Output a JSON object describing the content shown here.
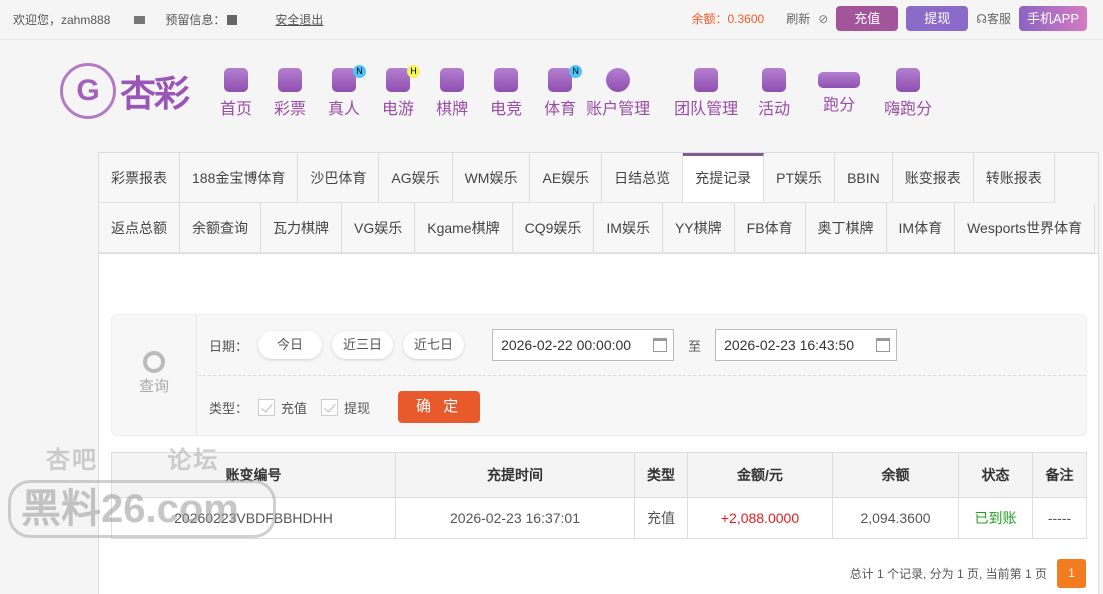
{
  "topbar": {
    "welcome": "欢迎您，zahm888",
    "reserve_info": "预留信息：",
    "logout": "安全退出",
    "balance_label": "余额：",
    "balance": "0.3600",
    "refresh": "刷新",
    "deposit": "充值",
    "withdraw": "提现",
    "service": "客服",
    "app": "手机APP"
  },
  "logo": {
    "text": "杏彩"
  },
  "nav": [
    {
      "label": "首页"
    },
    {
      "label": "彩票"
    },
    {
      "label": "真人",
      "badge": "N"
    },
    {
      "label": "电游",
      "badge": "H"
    },
    {
      "label": "棋牌"
    },
    {
      "label": "电竞"
    },
    {
      "label": "体育",
      "badge": "N"
    },
    {
      "label": "账户管理"
    },
    {
      "label": "团队管理"
    },
    {
      "label": "活动"
    },
    {
      "label": "跑分"
    },
    {
      "label": "嗨跑分"
    }
  ],
  "tabs": [
    "彩票报表",
    "188金宝博体育",
    "沙巴体育",
    "AG娱乐",
    "WM娱乐",
    "AE娱乐",
    "日结总览",
    "充提记录",
    "PT娱乐",
    "BBIN",
    "账变报表",
    "转账报表",
    "返点总额",
    "余额查询",
    "瓦力棋牌",
    "VG娱乐",
    "Kgame棋牌",
    "CQ9娱乐",
    "IM娱乐",
    "YY棋牌",
    "FB体育",
    "奥丁棋牌",
    "IM体育",
    "Wesports世界体育"
  ],
  "active_tab": "充提记录",
  "filter": {
    "query": "查询",
    "date_label": "日期：",
    "today": "今日",
    "three_days": "近三日",
    "seven_days": "近七日",
    "start": "2026-02-22 00:00:00",
    "to": "至",
    "end": "2026-02-23 16:43:50",
    "type_label": "类型：",
    "type_deposit": "充值",
    "type_withdraw": "提现",
    "confirm": "确 定"
  },
  "table": {
    "headers": [
      "账变编号",
      "充提时间",
      "类型",
      "金额/元",
      "余额",
      "状态",
      "备注"
    ],
    "rows": [
      [
        "20260223VBDFBBHDHH",
        "2026-02-23 16:37:01",
        "充值",
        "+2,088.0000",
        "2,094.3600",
        "已到账",
        "-----"
      ]
    ]
  },
  "pager": {
    "summary": "总计 1 个记录, 分为 1 页, 当前第 1 页",
    "page": "1"
  },
  "watermark": {
    "line1": "杏吧        论坛",
    "line2": "黑料26.com"
  },
  "colors": {
    "brand": "#9a4da5",
    "deposit_btn": "#a2559a",
    "withdraw_btn": "#8a6bc8",
    "amount": "#e02020",
    "status": "#22a022",
    "confirm": "#e85a2c",
    "page": "#f47c20"
  }
}
